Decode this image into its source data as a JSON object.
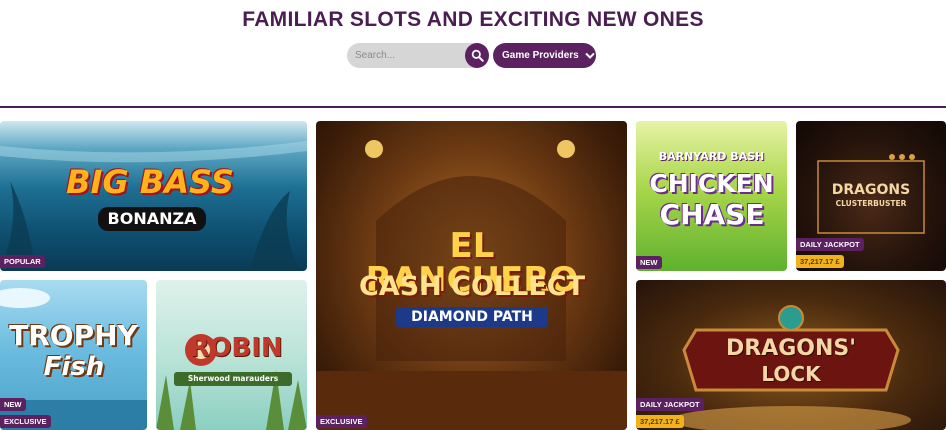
{
  "header": {
    "title": "FAMILIAR SLOTS AND EXCITING NEW ONES"
  },
  "search": {
    "placeholder": "Search..."
  },
  "filters": {
    "providers_label": "Game Providers"
  },
  "icons": {
    "search": "search-icon",
    "chevron": "chevron-down-icon"
  },
  "colors": {
    "brand": "#5b2160",
    "jackpot": "#f2b21b"
  },
  "games": {
    "big_bass": {
      "title_line1": "BIG BASS",
      "title_line2": "BONANZA",
      "badge": "POPULAR"
    },
    "el_ranchero": {
      "title_line1": "EL RANCHERO",
      "title_line2": "CASH COLLECT",
      "title_line3": "DIAMOND PATH",
      "badge": "EXCLUSIVE"
    },
    "chicken_chase": {
      "title_line1": "BARNYARD BASH",
      "title_line2": "CHICKEN",
      "title_line3": "CHASE",
      "badge": "NEW"
    },
    "dragons_cluster": {
      "title_line1": "DRAGONS",
      "title_line2": "CLUSTERBUSTER",
      "badge": "DAILY JACKPOT",
      "amount": "37,217.17 £"
    },
    "trophy_fish": {
      "title_line1": "TROPHY",
      "title_line2": "Fish",
      "badge_new": "NEW",
      "badge_exclusive": "EXCLUSIVE"
    },
    "robin": {
      "title_line1": "ROBIN",
      "title_line2": "Sherwood marauders"
    },
    "dragons_lock": {
      "title_line1": "DRAGONS'",
      "title_line2": "LOCK",
      "badge": "DAILY JACKPOT",
      "amount": "37,217.17 £"
    }
  }
}
